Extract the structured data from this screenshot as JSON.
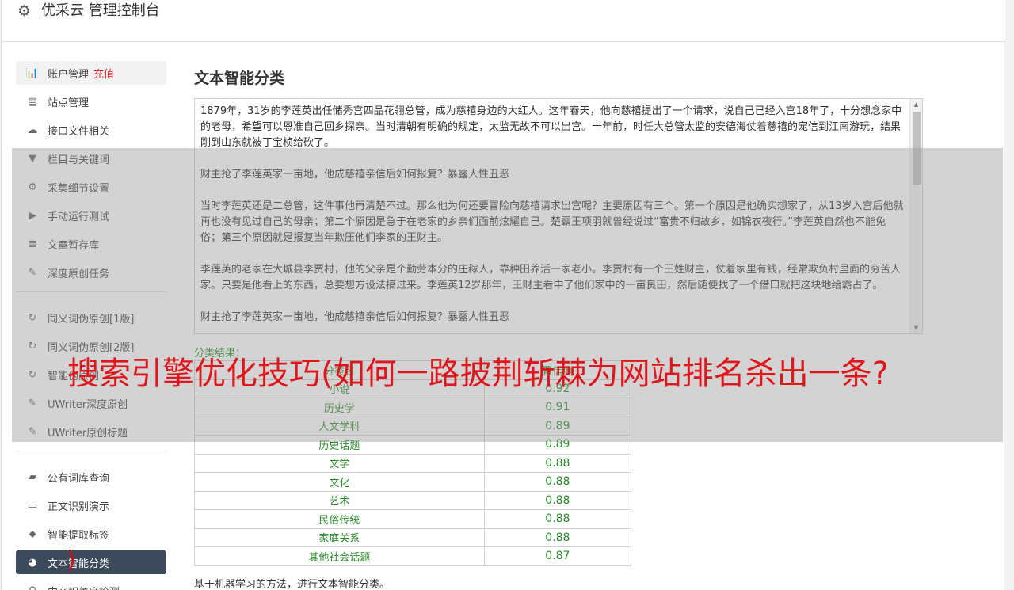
{
  "header": {
    "title": "优采云 管理控制台"
  },
  "sidebar": {
    "group1": [
      {
        "label": "账户管理",
        "badge": "充值",
        "icon": "bar-chart-icon",
        "glyph": "📊"
      },
      {
        "label": "站点管理",
        "icon": "server-icon",
        "glyph": "▤"
      },
      {
        "label": "接口文件相关",
        "icon": "cloud-upload-icon",
        "glyph": "☁"
      },
      {
        "label": "栏目与关键词",
        "icon": "filter-icon",
        "glyph": "▼"
      },
      {
        "label": "采集细节设置",
        "icon": "gears-icon",
        "glyph": "⚙"
      },
      {
        "label": "手动运行测试",
        "icon": "play-circle-icon",
        "glyph": "▶"
      },
      {
        "label": "文章暂存库",
        "icon": "database-icon",
        "glyph": "≣"
      },
      {
        "label": "深度原创任务",
        "icon": "edit-icon",
        "glyph": "✎"
      }
    ],
    "group2": [
      {
        "label": "同义词伪原创[1版]",
        "icon": "refresh-icon",
        "glyph": "↻"
      },
      {
        "label": "同义词伪原创[2版]",
        "icon": "refresh-icon",
        "glyph": "↻"
      },
      {
        "label": "智能伪原创",
        "icon": "refresh-icon",
        "glyph": "↻"
      },
      {
        "label": "UWriter深度原创",
        "icon": "edit-icon",
        "glyph": "✎"
      },
      {
        "label": "UWriter原创标题",
        "icon": "edit-icon",
        "glyph": "✎"
      }
    ],
    "group3": [
      {
        "label": "公有词库查询",
        "icon": "book-icon",
        "glyph": "▰"
      },
      {
        "label": "正文识别演示",
        "icon": "monitor-icon",
        "glyph": "▭"
      },
      {
        "label": "智能提取标签",
        "icon": "tag-icon",
        "glyph": "⬥"
      },
      {
        "label": "文本智能分类",
        "icon": "pie-chart-icon",
        "glyph": "◕",
        "active": true
      },
      {
        "label": "内容相关度检测",
        "icon": "search-icon",
        "glyph": "⚲"
      }
    ]
  },
  "main": {
    "title": "文本智能分类",
    "paragraphs": [
      "1879年，31岁的李莲英出任储秀宫四品花翎总管，成为慈禧身边的大红人。这年春天，他向慈禧提出了一个请求，说自己已经入宫18年了，十分想念家中的老母，希望可以恩准自己回乡探亲。当时清朝有明确的规定，太监无故不可以出宫。十年前，时任大总管太监的安德海仗着慈禧的宠信到江南游玩，结果刚到山东就被丁宝桢给砍了。",
      "财主抢了李莲英家一亩地，他成慈禧亲信后如何报复？暴露人性丑恶",
      "当时李莲英还是二总管，这件事他再清楚不过。那么他为何还要冒险向慈禧请求出宫呢？主要原因有三个。第一个原因是他确实想家了，从13岁入宫后他就再也没有见过自己的母亲；第二个原因是急于在老家的乡亲们面前炫耀自己。楚霸王项羽就曾经说过“富贵不归故乡，如锦衣夜行。”李莲英自然也不能免俗；第三个原因就是报复当年欺压他们李家的王财主。",
      "李莲英的老家在大城县李贾村，他的父亲是个勤劳本分的庄稼人，靠种田养活一家老小。李贾村有一个王姓财主，仗着家里有钱，经常欺负村里面的穷苦人家。只要是他看上的东西，总要想方设法搞过来。李莲英12岁那年，王财主看中了他们家中的一亩良田，然后随便找了一个借口就把这块地给霸占了。",
      "财主抢了李莲英家一亩地，他成慈禧亲信后如何报复？暴露人性丑恶"
    ],
    "result_label": "分类结果：",
    "table": {
      "headers": [
        "分类名",
        "置信度"
      ],
      "rows": [
        {
          "name": "小说",
          "score": "0.92"
        },
        {
          "name": "历史学",
          "score": "0.91"
        },
        {
          "name": "人文学科",
          "score": "0.89"
        },
        {
          "name": "历史话题",
          "score": "0.89"
        },
        {
          "name": "文学",
          "score": "0.88"
        },
        {
          "name": "文化",
          "score": "0.88"
        },
        {
          "name": "艺术",
          "score": "0.88"
        },
        {
          "name": "民俗传统",
          "score": "0.88"
        },
        {
          "name": "家庭关系",
          "score": "0.88"
        },
        {
          "name": "其他社会话题",
          "score": "0.87"
        }
      ]
    },
    "footnote": "基于机器学习的方法，进行文本智能分类。"
  },
  "overlay": {
    "banner_text": "搜索引擎优化技巧(如何一路披荆斩棘为网站排名杀出一条?",
    "mark": ")"
  },
  "colors": {
    "sidebar_active_bg": "#3c4a5c",
    "result_green": "#2a8a2a",
    "banner_red": "#e0161d",
    "recharge_red": "#d9232d"
  }
}
